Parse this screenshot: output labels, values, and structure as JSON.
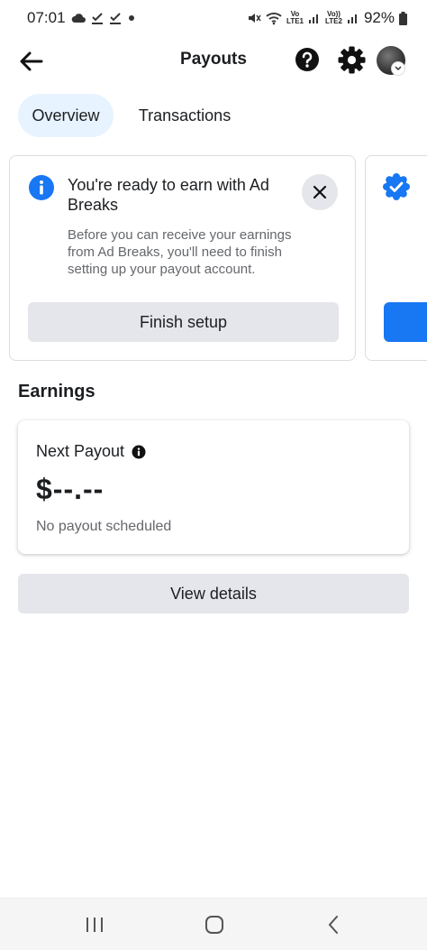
{
  "status_bar": {
    "time": "07:01",
    "battery": "92%",
    "net1_top": "Vo",
    "net1_bottom": "LTE1",
    "net2_top": "Vo))",
    "net2_bottom": "LTE2"
  },
  "app_bar": {
    "title": "Payouts"
  },
  "tabs": [
    {
      "label": "Overview",
      "selected": true
    },
    {
      "label": "Transactions",
      "selected": false
    }
  ],
  "ready_card": {
    "title": "You're ready to earn with Ad Breaks",
    "description": "Before you can receive your earnings from Ad Breaks, you'll need to finish setting up your payout account.",
    "button_label": "Finish setup"
  },
  "earnings": {
    "heading": "Earnings",
    "next_payout_label": "Next Payout",
    "amount": "$--.--",
    "status": "No payout scheduled",
    "view_details_label": "View details"
  },
  "colors": {
    "accent": "#1877f2",
    "tab_selected_bg": "#e7f3ff",
    "secondary_button_bg": "#e4e6eb"
  },
  "icons": [
    "back-arrow-icon",
    "help-icon",
    "gear-icon",
    "info-icon",
    "close-icon",
    "verified-badge-icon",
    "info-small-icon"
  ]
}
